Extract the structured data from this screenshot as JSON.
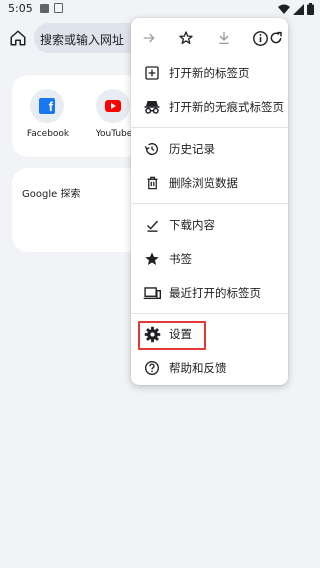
{
  "status_bar": {
    "time": "5:05"
  },
  "toolbar": {
    "omnibox_placeholder": "搜索或输入网址"
  },
  "ntp": {
    "tiles": [
      {
        "label": "Facebook",
        "icon": "facebook-icon",
        "color": "#1877f2"
      },
      {
        "label": "YouTube",
        "icon": "youtube-icon",
        "color": "#ff0000"
      }
    ],
    "google_search_label": "Google 探索"
  },
  "menu": {
    "top_actions": [
      "forward-icon",
      "star-icon",
      "download-icon",
      "info-icon",
      "refresh-icon"
    ],
    "items": [
      {
        "label": "打开新的标签页",
        "icon": "new-tab-icon"
      },
      {
        "label": "打开新的无痕式标签页",
        "icon": "incognito-icon"
      },
      {
        "label": "历史记录",
        "icon": "history-icon"
      },
      {
        "label": "删除浏览数据",
        "icon": "trash-icon"
      },
      {
        "label": "下载内容",
        "icon": "downloads-icon"
      },
      {
        "label": "书签",
        "icon": "bookmark-star-icon"
      },
      {
        "label": "最近打开的标签页",
        "icon": "recent-tabs-icon"
      },
      {
        "label": "设置",
        "icon": "settings-gear-icon",
        "highlighted": true
      },
      {
        "label": "帮助和反馈",
        "icon": "help-icon"
      }
    ]
  },
  "colors": {
    "background": "#f1f3f6",
    "menu_background": "#ffffff",
    "highlight_border": "#e53935",
    "icon": "#202124"
  }
}
